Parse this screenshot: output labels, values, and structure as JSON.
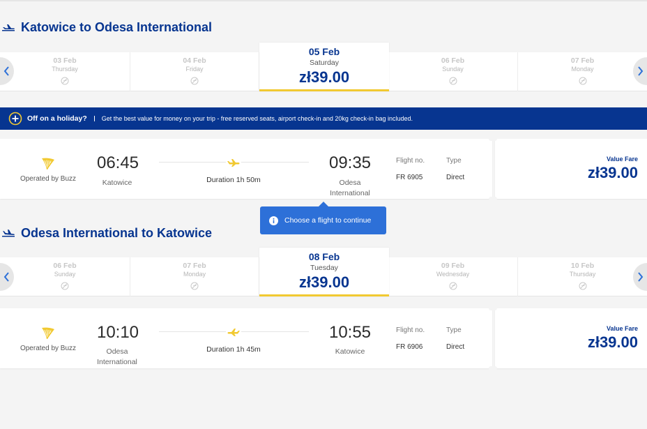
{
  "outbound": {
    "title": "Katowice to Odesa International",
    "dates": [
      {
        "date": "03 Feb",
        "weekday": "Thursday"
      },
      {
        "date": "04 Feb",
        "weekday": "Friday"
      },
      {
        "date": "05 Feb",
        "weekday": "Saturday",
        "price": "zł39.00",
        "selected": true
      },
      {
        "date": "06 Feb",
        "weekday": "Sunday"
      },
      {
        "date": "07 Feb",
        "weekday": "Monday"
      }
    ],
    "flight": {
      "operator": "Operated by Buzz",
      "depart_time": "06:45",
      "depart_city": "Katowice",
      "arrive_time": "09:35",
      "arrive_city_line1": "Odesa",
      "arrive_city_line2": "International",
      "duration": "Duration 1h 50m",
      "flight_no_label": "Flight no.",
      "flight_no": "FR 6905",
      "type_label": "Type",
      "type": "Direct",
      "fare_type": "Value Fare",
      "fare_price": "zł39.00"
    }
  },
  "banner": {
    "title": "Off on a holiday?",
    "text": "Get the best value for money on your trip - free reserved seats, airport check-in and 20kg check-in bag included."
  },
  "tooltip": {
    "text": "Choose a flight to continue",
    "icon": "info-icon"
  },
  "inbound": {
    "title": "Odesa International to Katowice",
    "dates": [
      {
        "date": "06 Feb",
        "weekday": "Sunday"
      },
      {
        "date": "07 Feb",
        "weekday": "Monday"
      },
      {
        "date": "08 Feb",
        "weekday": "Tuesday",
        "price": "zł39.00",
        "selected": true
      },
      {
        "date": "09 Feb",
        "weekday": "Wednesday"
      },
      {
        "date": "10 Feb",
        "weekday": "Thursday"
      }
    ],
    "flight": {
      "operator": "Operated by Buzz",
      "depart_time": "10:10",
      "depart_city_line1": "Odesa",
      "depart_city_line2": "International",
      "arrive_time": "10:55",
      "arrive_city": "Katowice",
      "duration": "Duration 1h 45m",
      "flight_no_label": "Flight no.",
      "flight_no": "FR 6906",
      "type_label": "Type",
      "type": "Direct",
      "fare_type": "Value Fare",
      "fare_price": "zł39.00"
    }
  },
  "colors": {
    "brand_blue": "#073590",
    "accent_yellow": "#f1c931",
    "tooltip_blue": "#2d70d8",
    "background": "#f4f4f4"
  }
}
